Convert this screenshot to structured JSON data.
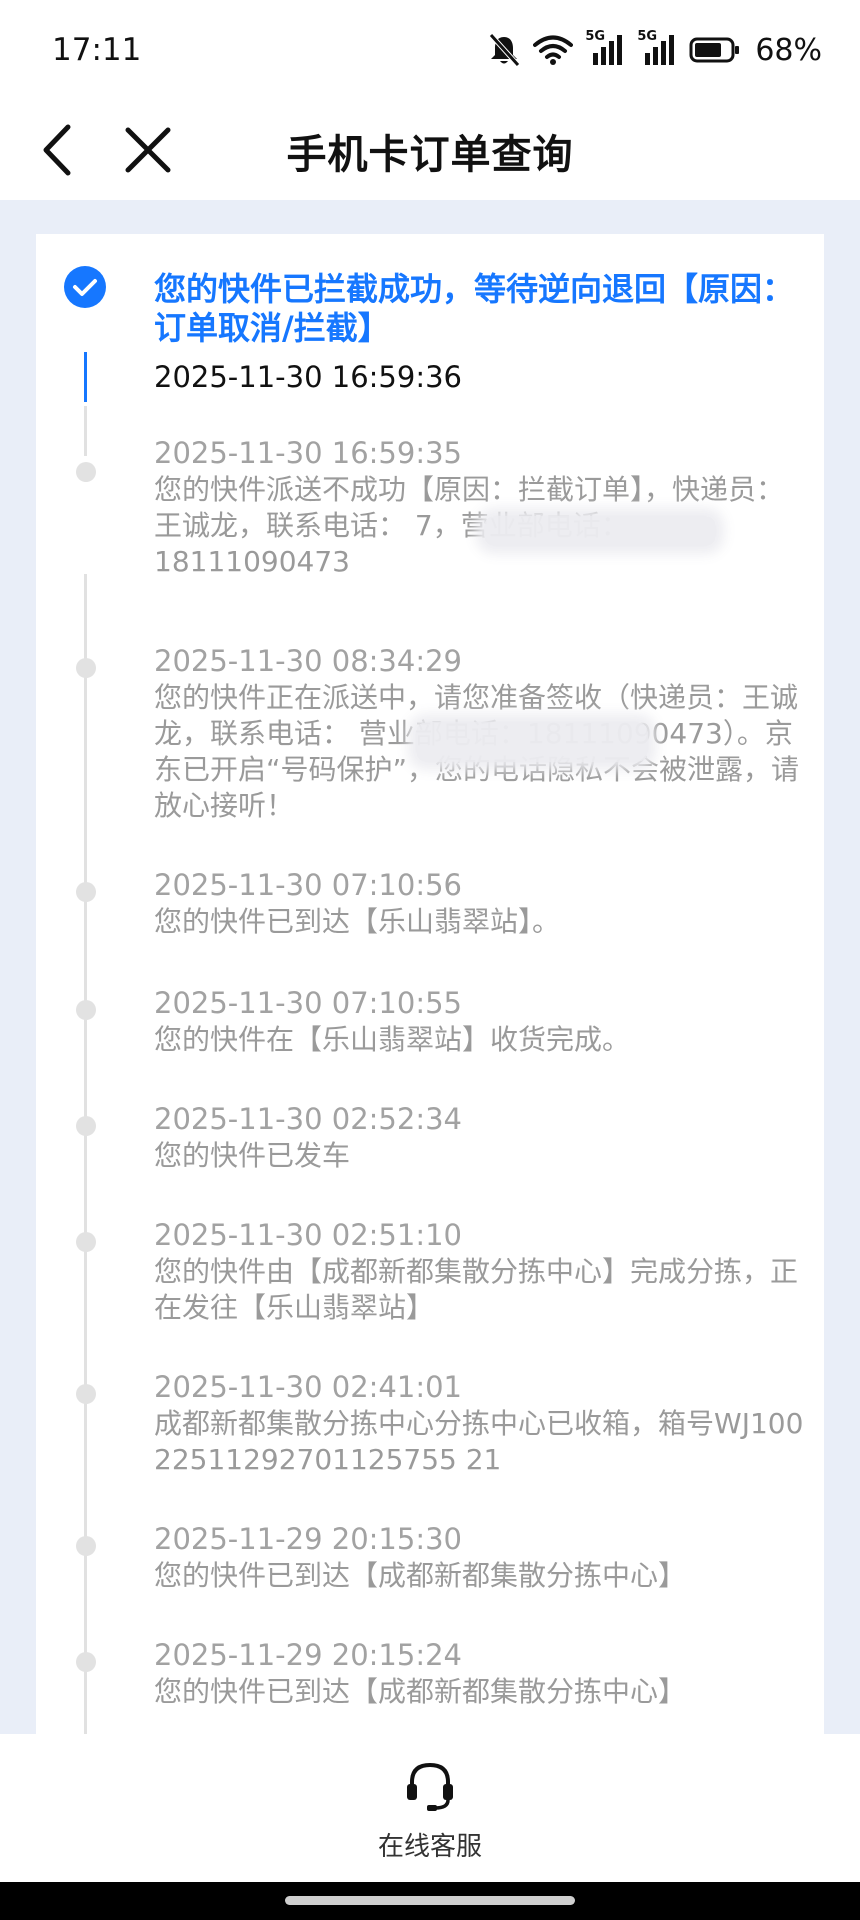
{
  "status_bar": {
    "time": "17:11",
    "battery": "68%",
    "network_1": "5G",
    "network_2": "5G",
    "icons": [
      "bell-off-icon",
      "wifi-icon",
      "signal-icon",
      "signal-icon",
      "battery-icon"
    ]
  },
  "header": {
    "title": "手机卡订单查询",
    "back_icon": "chevron-left-icon",
    "close_icon": "close-icon"
  },
  "timeline": [
    {
      "time": "2025-11-30 16:59:36",
      "desc": "您的快件已拦截成功，等待逆向退回【原因：订单取消/拦截】",
      "current": true
    },
    {
      "time": "2025-11-30 16:59:35",
      "desc": "您的快件派送不成功【原因：拦截订单】，快递员：王诚龙，联系电话：                    7，营业部电话：18111090473"
    },
    {
      "time": "2025-11-30 08:34:29",
      "desc": "您的快件正在派送中，请您准备签收（快递员：王诚龙，联系电话：                    营业部电话：18111090473）。京东已开启“号码保护”，您的电话隐私不会被泄露，请放心接听！"
    },
    {
      "time": "2025-11-30 07:10:56",
      "desc": "您的快件已到达【乐山翡翠站】。"
    },
    {
      "time": "2025-11-30 07:10:55",
      "desc": "您的快件在【乐山翡翠站】收货完成。"
    },
    {
      "time": "2025-11-30 02:52:34",
      "desc": "您的快件已发车"
    },
    {
      "time": "2025-11-30 02:51:10",
      "desc": "您的快件由【成都新都集散分拣中心】完成分拣，正在发往【乐山翡翠站】"
    },
    {
      "time": "2025-11-30 02:41:01",
      "desc": "成都新都集散分拣中心分拣中心已收箱，箱号WJ10022511292701125755 21"
    },
    {
      "time": "2025-11-29 20:15:30",
      "desc": "您的快件已到达【成都新都集散分拣中心】"
    },
    {
      "time": "2025-11-29 20:15:24",
      "desc": "您的快件已到达【成都新都集散分拣中心】"
    }
  ],
  "bottom": {
    "service_label": "在线客服",
    "service_icon": "headset-icon"
  },
  "colors": {
    "accent": "#1677ff",
    "page_bg": "#e9eef8",
    "muted_text": "#9a9a9a"
  }
}
